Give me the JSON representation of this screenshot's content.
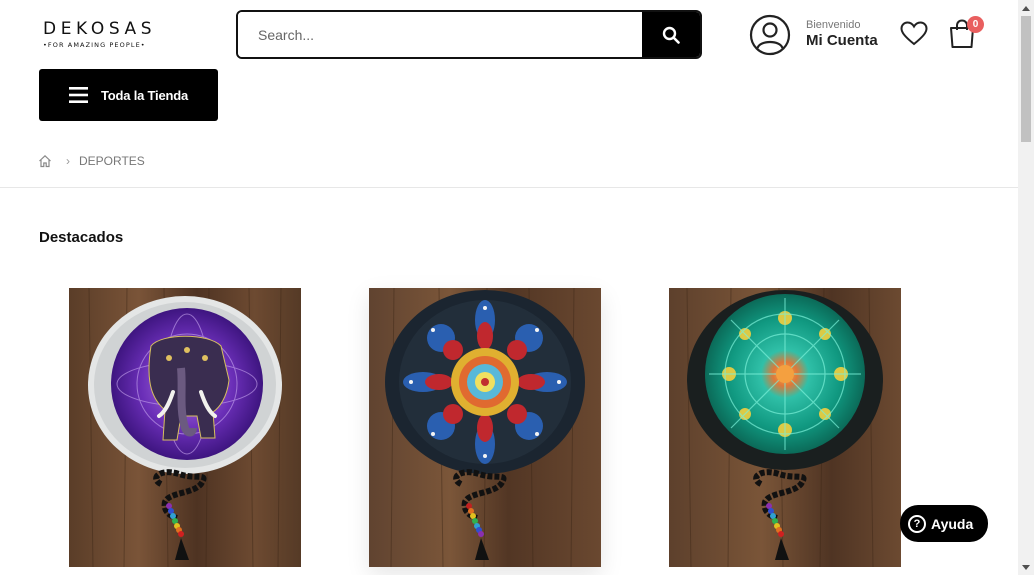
{
  "brand": {
    "name": "DEKOSAS",
    "tagline": "•FOR AMAZING PEOPLE•"
  },
  "search": {
    "placeholder": "Search..."
  },
  "account": {
    "greeting": "Bienvenido",
    "label": "Mi Cuenta"
  },
  "cart": {
    "count": "0"
  },
  "store_menu": {
    "label": "Toda la Tienda"
  },
  "breadcrumb": {
    "current": "DEPORTES"
  },
  "section": {
    "title": "Destacados"
  },
  "products": [
    {
      "image": "elephant-mandala-cushion"
    },
    {
      "image": "dot-mandala-cushion"
    },
    {
      "image": "green-kaleidoscope-cushion"
    }
  ],
  "help": {
    "label": "Ayuda"
  },
  "colors": {
    "accent": "#000000",
    "badge": "#e95f5f",
    "divider": "#e7e7e7"
  }
}
